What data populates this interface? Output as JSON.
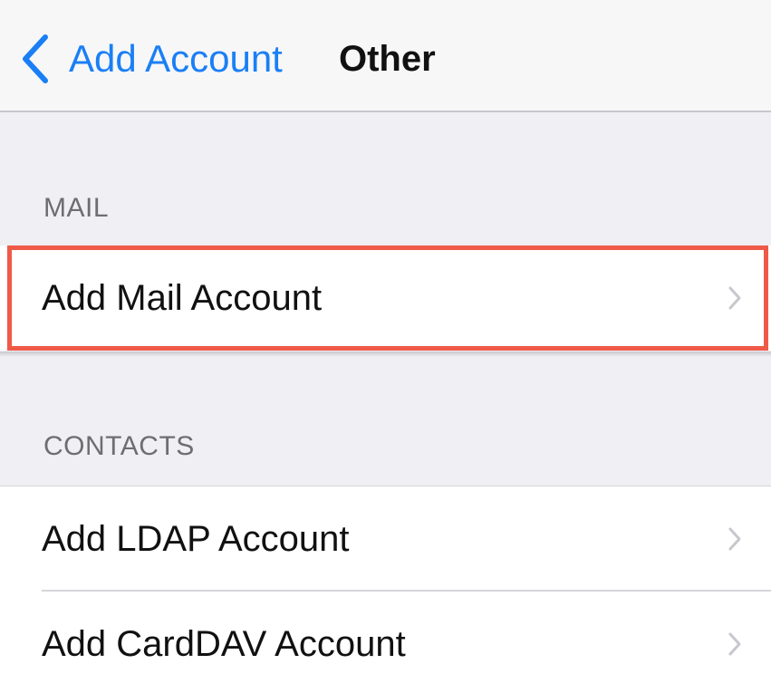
{
  "navbar": {
    "back_label": "Add Account",
    "title": "Other",
    "back_icon": "chevron-left-icon",
    "accent_color": "#1a7ff5"
  },
  "sections": [
    {
      "header": "MAIL",
      "rows": [
        {
          "label": "Add Mail Account",
          "icon": "chevron-right-icon",
          "highlighted": true
        }
      ]
    },
    {
      "header": "CONTACTS",
      "rows": [
        {
          "label": "Add LDAP Account",
          "icon": "chevron-right-icon"
        },
        {
          "label": "Add CardDAV Account",
          "icon": "chevron-right-icon"
        }
      ]
    }
  ],
  "highlight_color": "#ef5a48"
}
